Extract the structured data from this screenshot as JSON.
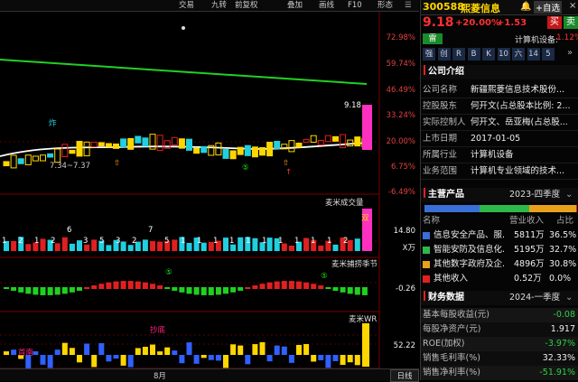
{
  "toolbar": {
    "items": [
      "交易",
      "九转",
      "前复权",
      "叠加",
      "画线",
      "F10",
      "形态"
    ],
    "stock_code": "300588",
    "stock_name": "熙菱信息",
    "self_select": "+自选"
  },
  "quote": {
    "price": "9.18",
    "change_pct": "+20.00%",
    "change": "+1.53",
    "buy": "买",
    "sell": "卖",
    "industry_label": "计算机设备:",
    "industry_change": "1.12%",
    "tags": [
      "雷"
    ],
    "tabs": [
      "强",
      "创",
      "R",
      "B",
      "K",
      "10",
      "六",
      "14",
      "5"
    ]
  },
  "chart": {
    "main_axis": [
      "72.98%",
      "59.74%",
      "46.49%",
      "33.24%",
      "20.00%",
      "6.75%",
      "-6.49%"
    ],
    "price_high": "9.18",
    "range_label": "7.34~7.37",
    "marker_top": "炸",
    "vol_title": "麦米成交量",
    "vol_axis": "14.80",
    "vol_unit": "X万",
    "vol_numbers": [
      "1",
      "2",
      "1",
      "2",
      "6",
      "3",
      "5",
      "3",
      "2",
      "7",
      "5",
      "1",
      "1",
      "1",
      "1",
      "1",
      "1",
      "1",
      "1",
      "1",
      "1",
      "2"
    ],
    "vol_top_icon": "双",
    "wave_title": "麦米捕捞季节",
    "wave_axis": "-0.26",
    "wr_title": "麦米WR",
    "wr_axis": "52.22",
    "wr_labels": [
      "首南",
      "抄底"
    ],
    "month_label": "8月",
    "period_button": "日线"
  },
  "company": {
    "title": "公司介绍",
    "rows": [
      {
        "k": "公司名称",
        "v": "新疆熙菱信息技术股份..."
      },
      {
        "k": "控股股东",
        "v": "何开文(占总股本比例: 2..."
      },
      {
        "k": "实际控制人",
        "v": "何开文、岳亚梅(占总股..."
      },
      {
        "k": "上市日期",
        "v": "2017-01-05"
      },
      {
        "k": "所属行业",
        "v": "计算机设备"
      },
      {
        "k": "业务范围",
        "v": "计算机专业领域的技术..."
      }
    ]
  },
  "products": {
    "title": "主营产品",
    "period": "2023-四季度",
    "headers": [
      "名称",
      "营业收入",
      "占比"
    ],
    "items": [
      {
        "color": "#3a6fd8",
        "name": "信息安全产品、服...",
        "revenue": "5811万",
        "pct": "36.5%"
      },
      {
        "color": "#2fb84a",
        "name": "智能安防及信息化...",
        "revenue": "5195万",
        "pct": "32.7%"
      },
      {
        "color": "#e8a21a",
        "name": "其他数字政府及企...",
        "revenue": "4896万",
        "pct": "30.8%"
      },
      {
        "color": "#e02020",
        "name": "其他收入",
        "revenue": "0.52万",
        "pct": "0.0%"
      }
    ]
  },
  "finance": {
    "title": "财务数据",
    "period": "2024-一季度",
    "rows": [
      {
        "k": "基本每股收益(元)",
        "v": "-0.08",
        "c": "#2fd04a"
      },
      {
        "k": "每股净资产(元)",
        "v": "1.917",
        "c": "#eeeeee"
      },
      {
        "k": "ROE(加权)",
        "v": "-3.97%",
        "c": "#2fd04a"
      },
      {
        "k": "销售毛利率(%)",
        "v": "32.33%",
        "c": "#eeeeee"
      },
      {
        "k": "销售净利率(%)",
        "v": "-51.91%",
        "c": "#2fd04a"
      }
    ]
  },
  "colors": {
    "up": "#e02020",
    "down": "#20d0e0",
    "ma": "#ffffff",
    "trend": "#22d022"
  }
}
